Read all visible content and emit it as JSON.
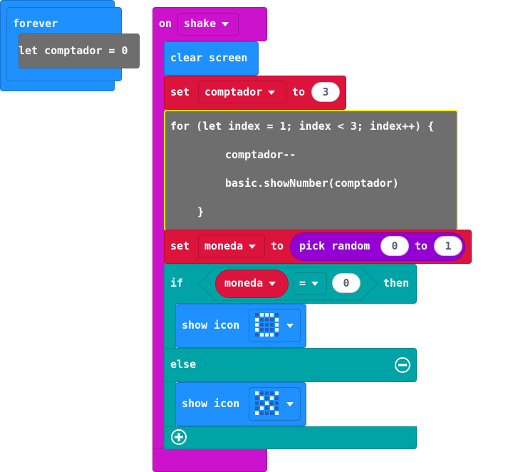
{
  "colors": {
    "loops": "#1e90ff",
    "loops_border": "#1873cc",
    "events": "#cc12cc",
    "variables": "#dc143c",
    "logic": "#00a4a6",
    "math": "#9400d3",
    "js": "#6e6e6e",
    "highlight": "#fff200"
  },
  "forever_block": {
    "label": "forever",
    "statement": "let comptador = 0"
  },
  "event_block": {
    "on_label": "on",
    "event": "shake"
  },
  "clear_block": {
    "label": "clear screen"
  },
  "set_comptador": {
    "set_label": "set",
    "variable": "comptador",
    "to_label": "to",
    "value": "3"
  },
  "js_block": {
    "line1": "for (let index = 1; index < 3; index++) {",
    "line2": "comptador--",
    "line3": "basic.showNumber(comptador)",
    "line4": "}"
  },
  "set_moneda": {
    "set_label": "set",
    "variable": "moneda",
    "to_label": "to",
    "random_label": "pick random",
    "from": "0",
    "to_word": "to",
    "to_value": "1"
  },
  "if_block": {
    "if_label": "if",
    "variable": "moneda",
    "operator": "=",
    "compare_value": "0",
    "then_label": "then",
    "else_label": "else"
  },
  "show_icon_1": {
    "label": "show icon",
    "icon": "ring-icon",
    "pattern": [
      [
        0,
        1,
        1,
        1,
        0
      ],
      [
        1,
        0,
        0,
        0,
        1
      ],
      [
        1,
        0,
        0,
        0,
        1
      ],
      [
        1,
        0,
        0,
        0,
        1
      ],
      [
        0,
        1,
        1,
        1,
        0
      ]
    ]
  },
  "show_icon_2": {
    "label": "show icon",
    "icon": "x-icon",
    "pattern": [
      [
        1,
        0,
        0,
        0,
        1
      ],
      [
        0,
        1,
        0,
        1,
        0
      ],
      [
        0,
        0,
        1,
        0,
        0
      ],
      [
        0,
        1,
        0,
        1,
        0
      ],
      [
        1,
        0,
        0,
        0,
        1
      ]
    ]
  }
}
